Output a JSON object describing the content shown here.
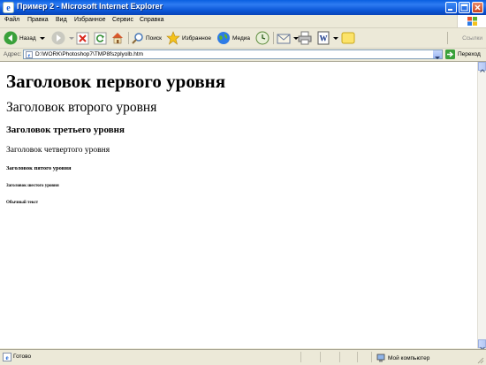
{
  "window": {
    "title": "Пример 2 - Microsoft Internet Explorer"
  },
  "menu": {
    "items": [
      "Файл",
      "Правка",
      "Вид",
      "Избранное",
      "Сервис",
      "Справка"
    ]
  },
  "toolbar": {
    "back_label": "Назад",
    "search_label": "Поиск",
    "favorites_label": "Избранное",
    "media_label": "Медиа",
    "links_label": "Ссылки"
  },
  "address": {
    "label": "Адрес:",
    "url": "D:\\WORK\\Photoshop7\\TMP8fszplyolb.htm",
    "go_label": "Переход"
  },
  "page": {
    "h1": "Заголовок первого уровня",
    "h2": "Заголовок второго уровня",
    "h3": "Заголовок третьего уровня",
    "h4": "Заголовок четвертого уровня",
    "h5": "Заголовок пятого уровня",
    "h6": "Заголовок шестого уровня",
    "paragraph": "Обычный текст"
  },
  "status": {
    "text": "Готово",
    "zone": "Мой компьютер"
  },
  "colors": {
    "titlebar": "#0A5FE0",
    "chrome": "#ECE9D8"
  }
}
